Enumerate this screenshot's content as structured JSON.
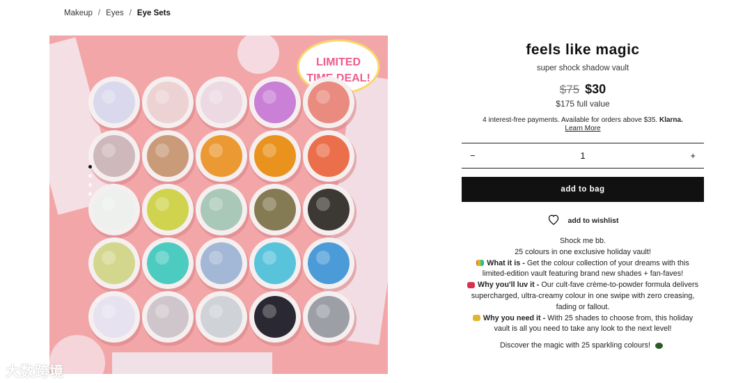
{
  "breadcrumb": {
    "items": [
      "Makeup",
      "Eyes",
      "Eye Sets"
    ],
    "sep": "/"
  },
  "product": {
    "title": "feels like magic",
    "subtitle": "super shock shadow vault",
    "old_price": "$75",
    "new_price": "$30",
    "full_value": "$175 full value",
    "klarna_text": "4 interest-free payments. Available for orders above $35.",
    "klarna_brand": "Klarna.",
    "learn_more": "Learn More",
    "badge": [
      "LIMITED",
      "TIME DEAL!"
    ]
  },
  "quantity": {
    "minus": "−",
    "value": "1",
    "plus": "+"
  },
  "actions": {
    "add_to_bag": "add to bag",
    "wishlist": "add to wishlist"
  },
  "description": {
    "line1": "Shock me bb.",
    "line2": "25 colours in one exclusive holiday vault!",
    "what_label": "What it is -",
    "what_text": "Get the colour collection of your dreams with this limited-edition vault featuring brand new shades + fan-faves!",
    "why_label": "Why you'll luv it -",
    "why_text": "Our cult-fave crème-to-powder formula delivers supercharged, ultra-creamy colour in one swipe with zero creasing, fading or fallout.",
    "need_label": "Why you need it -",
    "need_text": "With 25 shades to choose from, this holiday vault is all you need to take any look to the next level!",
    "closing": "Discover the magic with 25 sparkling colours!"
  },
  "swatches": [
    [
      "#d9d8ec",
      "#ecd2d2",
      "#ecd9e2",
      "#c980d6",
      "#e98b7e"
    ],
    [
      "#ceb8bb",
      "#c99b78",
      "#eb9a33",
      "#e9921d",
      "#ec6f4c"
    ],
    [
      "#eef0ee",
      "#cfd34d",
      "#a9c8b8",
      "#847a53",
      "#3c3834"
    ],
    [
      "#d3d78e",
      "#4ccbc0",
      "#a3b7d6",
      "#5ac3dc",
      "#4b9bd8"
    ],
    [
      "#e6e2f0",
      "#cfc6cc",
      "#cfd2d6",
      "#2a2832",
      "#9c9fa6"
    ]
  ],
  "watermark": "大数跨境",
  "colors": {
    "accent": "#111111",
    "bg_image": "#f4a9ab"
  }
}
